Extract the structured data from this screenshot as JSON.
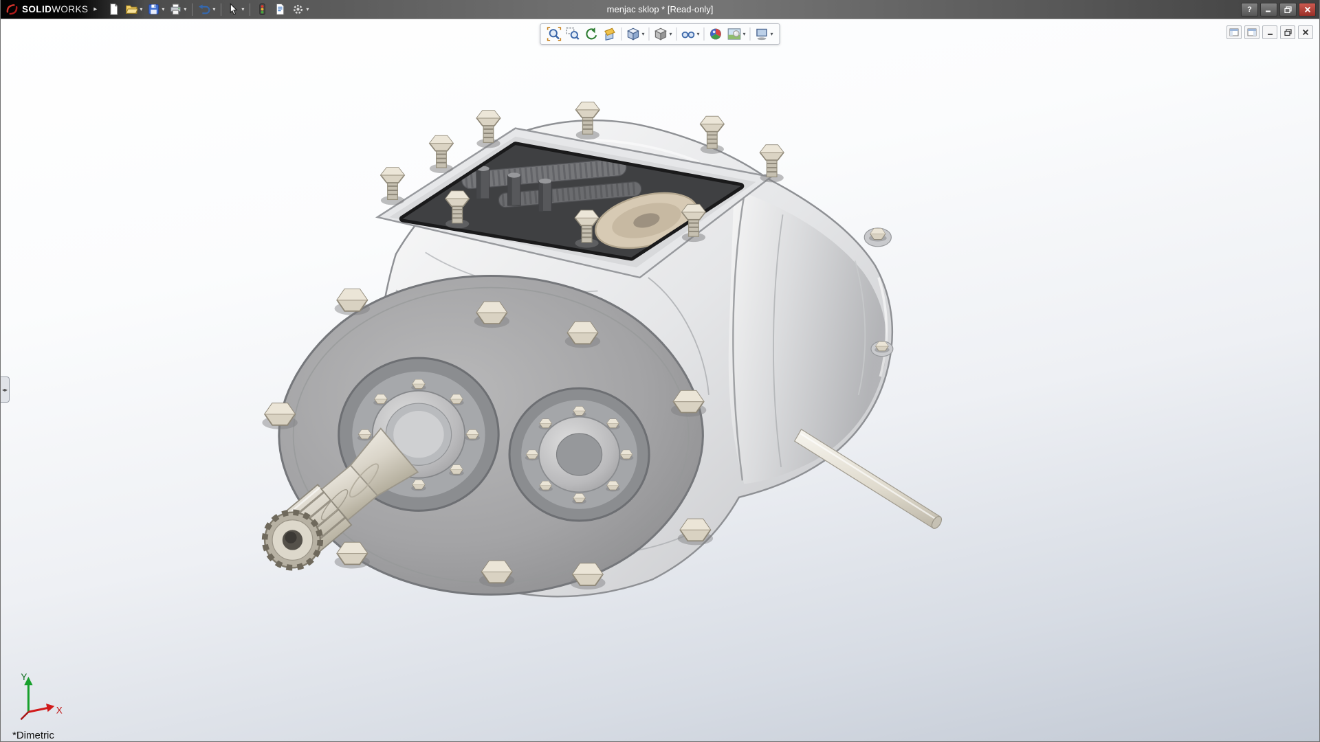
{
  "window": {
    "brand": {
      "solid": "SOLID",
      "works": "WORKS"
    },
    "title": "menjac sklop * [Read-only]",
    "help_label": "?"
  },
  "main_toolbar": {
    "buttons": [
      {
        "name": "new-document",
        "dropdown": false
      },
      {
        "name": "open",
        "dropdown": true
      },
      {
        "name": "save",
        "dropdown": true
      },
      {
        "name": "print",
        "dropdown": true
      },
      {
        "name": "undo",
        "dropdown": true
      },
      {
        "name": "select",
        "dropdown": true
      },
      {
        "name": "rebuild",
        "dropdown": false
      },
      {
        "name": "file-properties",
        "dropdown": false
      },
      {
        "name": "options",
        "dropdown": true
      }
    ]
  },
  "heads_up_toolbar": {
    "buttons": [
      {
        "name": "zoom-to-fit",
        "dropdown": false
      },
      {
        "name": "zoom-to-area",
        "dropdown": false
      },
      {
        "name": "previous-view",
        "dropdown": false
      },
      {
        "name": "section-view",
        "dropdown": false
      },
      {
        "name": "view-orientation",
        "dropdown": true
      },
      {
        "name": "display-style",
        "dropdown": true
      },
      {
        "name": "hide-show-items",
        "dropdown": true
      },
      {
        "name": "edit-appearance",
        "dropdown": false
      },
      {
        "name": "apply-scene",
        "dropdown": true
      },
      {
        "name": "view-settings",
        "dropdown": true
      }
    ]
  },
  "document_window_controls": [
    "feature-pane-toggle",
    "display-pane-toggle",
    "minimize",
    "restore",
    "close"
  ],
  "viewport": {
    "view_orientation_label": "*Dimetric",
    "triad": {
      "x_label": "X",
      "y_label": "Y"
    }
  },
  "colors": {
    "accent_red": "#c8102e",
    "titlebar_gray": "#6e6e6e",
    "viewport_top": "#ffffff",
    "viewport_bottom": "#c2c9d4",
    "bolt_tan": "#d9d2c2",
    "housing_gray": "#a2a2a2"
  }
}
